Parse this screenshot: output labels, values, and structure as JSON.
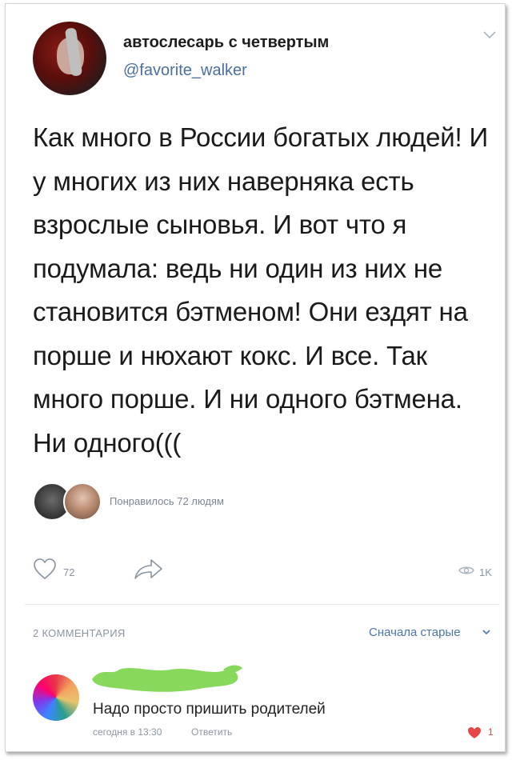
{
  "post": {
    "author_name": "автослесарь с четвертым",
    "author_handle": "@favorite_walker",
    "text": "Как много в России богатых людей! И у многих из них наверняка есть взрослые сыновья. И вот что я подумала: ведь ни один из них не становится бэтменом! Они ездят на порше и нюхают кокс. И все. Так много порше. И ни одного бэтмена. Ни одного(((",
    "liked_by_text": "Понравилось 72 людям"
  },
  "actions": {
    "like_count": "72",
    "views_count": "1K"
  },
  "comments": {
    "count_label": "2 КОММЕНТАРИЯ",
    "sort_label": "Сначала старые",
    "items": [
      {
        "text": "Надо просто пришить родителей",
        "time": "сегодня в 13:30",
        "reply_label": "Ответить",
        "like_count": "1"
      }
    ]
  },
  "colors": {
    "link": "#4a76a8",
    "muted": "#8a95a1",
    "like_red": "#e64646",
    "scribble_green": "#88d85b"
  },
  "icons": [
    "chevron-down-icon",
    "heart-icon",
    "share-icon",
    "eye-icon"
  ]
}
